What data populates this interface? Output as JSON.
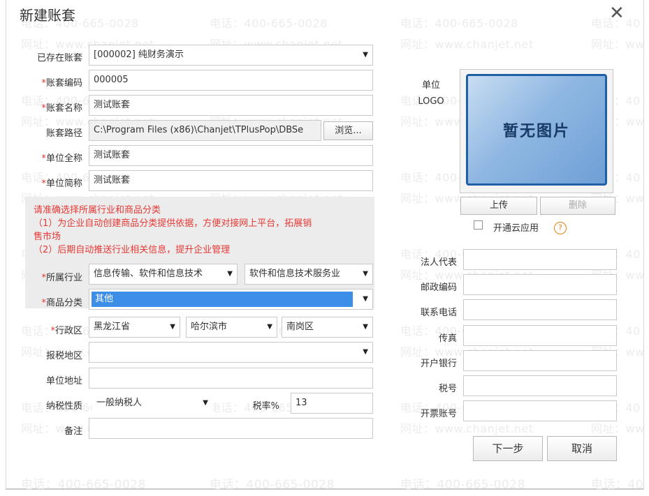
{
  "dialog": {
    "title": "新建账套",
    "close_glyph": "✕"
  },
  "watermark": {
    "phone": "电话：400-665-0028",
    "site": "网址：www.chanjet.net",
    "phone_short": "电话：40",
    "site_short": "网址：ww"
  },
  "form": {
    "existing": {
      "label": "已存在账套",
      "value": "[000002] 纯财务演示"
    },
    "code": {
      "req": "*",
      "label": "账套编码",
      "value": "000005"
    },
    "name": {
      "req": "*",
      "label": "账套名称",
      "value": "测试账套"
    },
    "path": {
      "label": "账套路径",
      "value": "C:\\Program Files (x86)\\Chanjet\\TPlusPop\\DBSe",
      "browse_label": "浏览..."
    },
    "full_name": {
      "req": "*",
      "label": "单位全称",
      "value": "测试账套"
    },
    "short_name": {
      "req": "*",
      "label": "单位简称",
      "value": "测试账套"
    },
    "notice": {
      "heading": "请准确选择所属行业和商品分类",
      "line1": "（1）为企业自动创建商品分类提供依据，方便对接网上平台，拓展销",
      "line1b": "售市场",
      "line2": "（2）后期自动推送行业相关信息，提升企业管理"
    },
    "industry": {
      "req": "*",
      "label": "所属行业",
      "value1": "信息传输、软件和信息技术",
      "value2": "软件和信息技术服务业"
    },
    "category": {
      "req": "*",
      "label": "商品分类",
      "value": "其他"
    },
    "region": {
      "req": "*",
      "label": "行政区",
      "province": "黑龙江省",
      "city": "哈尔滨市",
      "district": "南岗区"
    },
    "tax_area": {
      "label": "报税地区",
      "value": ""
    },
    "address": {
      "label": "单位地址",
      "value": ""
    },
    "taxpayer": {
      "label": "纳税性质",
      "value": "一般纳税人"
    },
    "tax_rate": {
      "label": "税率%",
      "value": "13"
    },
    "remark": {
      "label": "备注",
      "value": ""
    }
  },
  "right": {
    "logo_label_1": "单位",
    "logo_label_2": "LOGO",
    "logo_placeholder": "暂无图片",
    "upload_label": "上传",
    "delete_label": "删除",
    "cloud_label": "开通云应用",
    "help_glyph": "?",
    "legal_rep": {
      "label": "法人代表",
      "value": ""
    },
    "postal": {
      "label": "邮政编码",
      "value": ""
    },
    "phone": {
      "label": "联系电话",
      "value": ""
    },
    "fax": {
      "label": "传真",
      "value": ""
    },
    "bank": {
      "label": "开户银行",
      "value": ""
    },
    "tax_no": {
      "label": "税号",
      "value": ""
    },
    "invoice_acct": {
      "label": "开票账号",
      "value": ""
    }
  },
  "footer": {
    "next_label": "下一步",
    "cancel_label": "取消"
  },
  "colors": {
    "required": "#e53935",
    "selection_blue": "#3d8ee6",
    "logo_border": "#1f5fa6"
  }
}
